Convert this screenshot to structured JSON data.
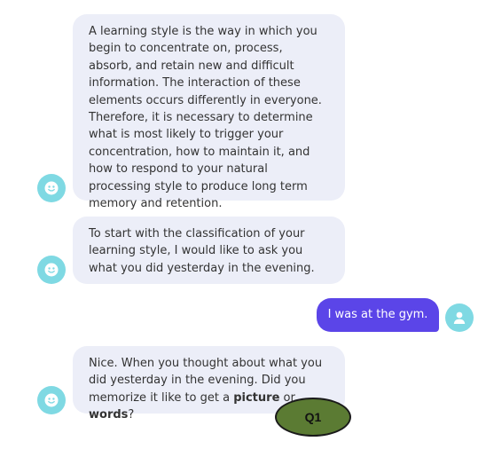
{
  "messages": [
    {
      "sender": "bot",
      "text": "A learning style is the way in which you begin to concentrate on, process, absorb, and retain new and difficult information. The interaction of these elements occurs differently in everyone. Therefore, it is necessary to determine what is most likely to trigger your concentration, how to maintain it, and how to respond to your natural processing style to produce long term memory and retention."
    },
    {
      "sender": "bot",
      "text": "To start with the classification of your learning style, I would like to ask you what you did yesterday in the evening."
    },
    {
      "sender": "user",
      "text": "I was at the gym."
    },
    {
      "sender": "bot",
      "text_before": "Nice. When you thought about what you did yesterday in the evening. Did you memorize it like to get a ",
      "bold1": "picture",
      "text_middle": " or ",
      "bold2": "words",
      "text_after": "?"
    }
  ],
  "annotation": {
    "label": "Q1",
    "color": "#5b7b33"
  },
  "colors": {
    "bot_bubble": "#eceef8",
    "user_bubble": "#5b45e8",
    "avatar": "#7fd9e3"
  },
  "icons": {
    "bot_avatar": "smiley-face-icon",
    "user_avatar": "user-silhouette-icon"
  }
}
